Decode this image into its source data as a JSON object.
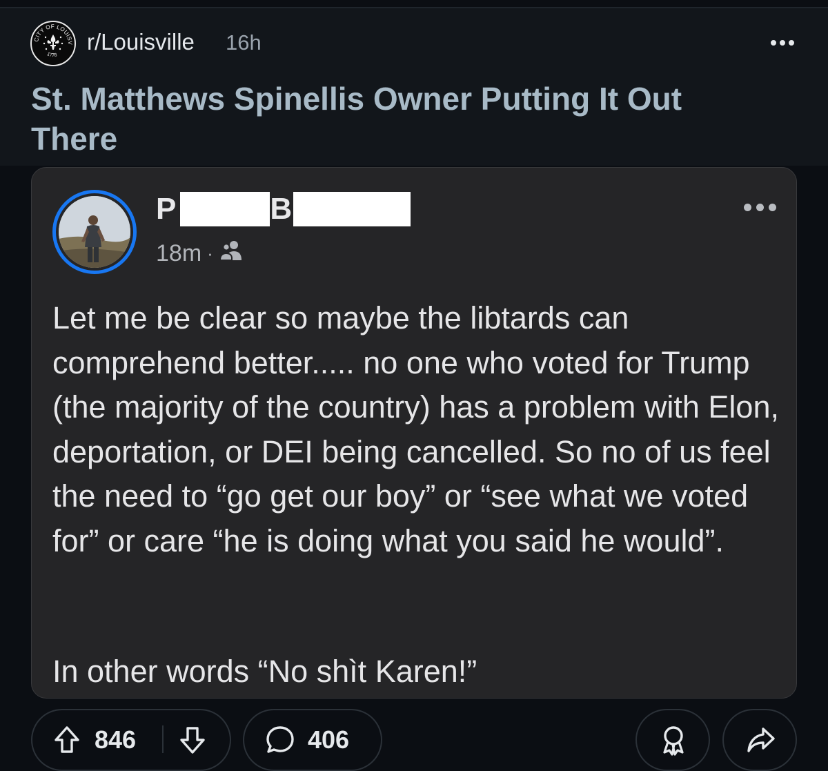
{
  "post": {
    "subreddit": "r/Louisville",
    "age": "16h",
    "title": "St. Matthews Spinellis Owner Putting It Out There",
    "subreddit_icon": {
      "name": "city-of-louisville-seal-icon",
      "seal_text": "CITY OF LOUISVILLE",
      "seal_year": "1778"
    }
  },
  "facebook_post": {
    "author_initial_first": "P",
    "author_initial_last": "B",
    "time": "18m",
    "separator": "·",
    "audience_icon": "friends-icon",
    "body_paragraph_1": "Let me be clear so maybe the libtards can comprehend better..... no one who voted for Trump (the majority of the country) has a problem with Elon, deportation, or DEI being cancelled. So no of us feel the need to “go get our boy” or “see what we voted for” or care “he is doing what you said he would”.",
    "body_paragraph_2": "In other words “No shìt Karen!”"
  },
  "actions": {
    "upvotes": "846",
    "comments": "406",
    "upvote_icon": "upvote-arrow-icon",
    "downvote_icon": "downvote-arrow-icon",
    "comment_icon": "comment-bubble-icon",
    "award_icon": "award-icon",
    "share_icon": "share-arrow-icon"
  },
  "colors": {
    "background": "#0b0e13",
    "header_background": "#12161b",
    "title": "#a8bac7",
    "card_background": "#252527",
    "avatar_ring": "#1877f2"
  }
}
